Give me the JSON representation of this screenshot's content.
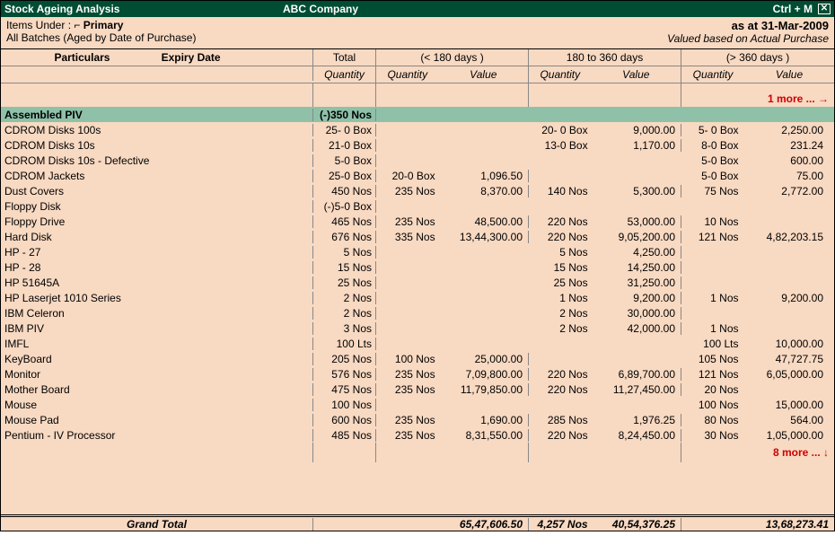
{
  "title_left": "Stock Ageing Analysis",
  "title_center": "ABC Company",
  "title_right_shortcut": "Ctrl + M",
  "close_glyph": "✕",
  "meta": {
    "items_under_label": "Items Under :",
    "items_under_marker": "⌐",
    "items_under_value": "Primary",
    "batches_line": "All Batches (Aged by Date of Purchase)",
    "as_at": "as at 31-Mar-2009",
    "valuation": "Valued based on Actual Purchase"
  },
  "headers": {
    "particulars": "Particulars",
    "expiry": "Expiry Date",
    "total": "Total",
    "group1": "(< 180 days )",
    "group2": "180 to 360 days",
    "group3": "(> 360 days )",
    "quantity": "Quantity",
    "value": "Value"
  },
  "more_top": "1 more ... →",
  "more_bottom": "8 more ... ↓",
  "highlight_row": {
    "name": "Assembled PIV",
    "total_qty": "(-)350 Nos"
  },
  "rows": [
    {
      "name": "CDROM Disks 100s",
      "total": "25- 0 Box",
      "g2q": "20- 0 Box",
      "g2v": "9,000.00",
      "g3q": "5- 0 Box",
      "g3v": "2,250.00"
    },
    {
      "name": "CDROM Disks 10s",
      "total": "21-0 Box",
      "g2q": "13-0 Box",
      "g2v": "1,170.00",
      "g3q": "8-0 Box",
      "g3v": "231.24"
    },
    {
      "name": "CDROM Disks 10s - Defective",
      "total": "5-0 Box",
      "g3q": "5-0 Box",
      "g3v": "600.00"
    },
    {
      "name": "CDROM Jackets",
      "total": "25-0 Box",
      "g1q": "20-0 Box",
      "g1v": "1,096.50",
      "g3q": "5-0 Box",
      "g3v": "75.00"
    },
    {
      "name": "Dust Covers",
      "total": "450 Nos",
      "g1q": "235 Nos",
      "g1v": "8,370.00",
      "g2q": "140 Nos",
      "g2v": "5,300.00",
      "g3q": "75 Nos",
      "g3v": "2,772.00"
    },
    {
      "name": "Floppy Disk",
      "total": "(-)5-0 Box"
    },
    {
      "name": "Floppy Drive",
      "total": "465 Nos",
      "g1q": "235 Nos",
      "g1v": "48,500.00",
      "g2q": "220 Nos",
      "g2v": "53,000.00",
      "g3q": "10 Nos"
    },
    {
      "name": "Hard Disk",
      "total": "676 Nos",
      "g1q": "335 Nos",
      "g1v": "13,44,300.00",
      "g2q": "220 Nos",
      "g2v": "9,05,200.00",
      "g3q": "121 Nos",
      "g3v": "4,82,203.15"
    },
    {
      "name": "HP - 27",
      "total": "5 Nos",
      "g2q": "5 Nos",
      "g2v": "4,250.00"
    },
    {
      "name": "HP - 28",
      "total": "15 Nos",
      "g2q": "15 Nos",
      "g2v": "14,250.00"
    },
    {
      "name": "HP 51645A",
      "total": "25 Nos",
      "g2q": "25 Nos",
      "g2v": "31,250.00"
    },
    {
      "name": "HP Laserjet 1010 Series",
      "total": "2 Nos",
      "g2q": "1 Nos",
      "g2v": "9,200.00",
      "g3q": "1 Nos",
      "g3v": "9,200.00"
    },
    {
      "name": "IBM Celeron",
      "total": "2 Nos",
      "g2q": "2 Nos",
      "g2v": "30,000.00"
    },
    {
      "name": "IBM PIV",
      "total": "3 Nos",
      "g2q": "2 Nos",
      "g2v": "42,000.00",
      "g3q": "1 Nos"
    },
    {
      "name": "IMFL",
      "total": "100 Lts",
      "g3q": "100 Lts",
      "g3v": "10,000.00"
    },
    {
      "name": "KeyBoard",
      "total": "205 Nos",
      "g1q": "100 Nos",
      "g1v": "25,000.00",
      "g3q": "105 Nos",
      "g3v": "47,727.75"
    },
    {
      "name": "Monitor",
      "total": "576 Nos",
      "g1q": "235 Nos",
      "g1v": "7,09,800.00",
      "g2q": "220 Nos",
      "g2v": "6,89,700.00",
      "g3q": "121 Nos",
      "g3v": "6,05,000.00"
    },
    {
      "name": "Mother Board",
      "total": "475 Nos",
      "g1q": "235 Nos",
      "g1v": "11,79,850.00",
      "g2q": "220 Nos",
      "g2v": "11,27,450.00",
      "g3q": "20 Nos"
    },
    {
      "name": "Mouse",
      "total": "100 Nos",
      "g3q": "100 Nos",
      "g3v": "15,000.00"
    },
    {
      "name": "Mouse Pad",
      "total": "600 Nos",
      "g1q": "235 Nos",
      "g1v": "1,690.00",
      "g2q": "285 Nos",
      "g2v": "1,976.25",
      "g3q": "80 Nos",
      "g3v": "564.00"
    },
    {
      "name": "Pentium - IV Processor",
      "total": "485 Nos",
      "g1q": "235 Nos",
      "g1v": "8,31,550.00",
      "g2q": "220 Nos",
      "g2v": "8,24,450.00",
      "g3q": "30 Nos",
      "g3v": "1,05,000.00"
    }
  ],
  "grand": {
    "label": "Grand Total",
    "g1v": "65,47,606.50",
    "g2q": "4,257 Nos",
    "g2v": "40,54,376.25",
    "g3v": "13,68,273.41"
  }
}
